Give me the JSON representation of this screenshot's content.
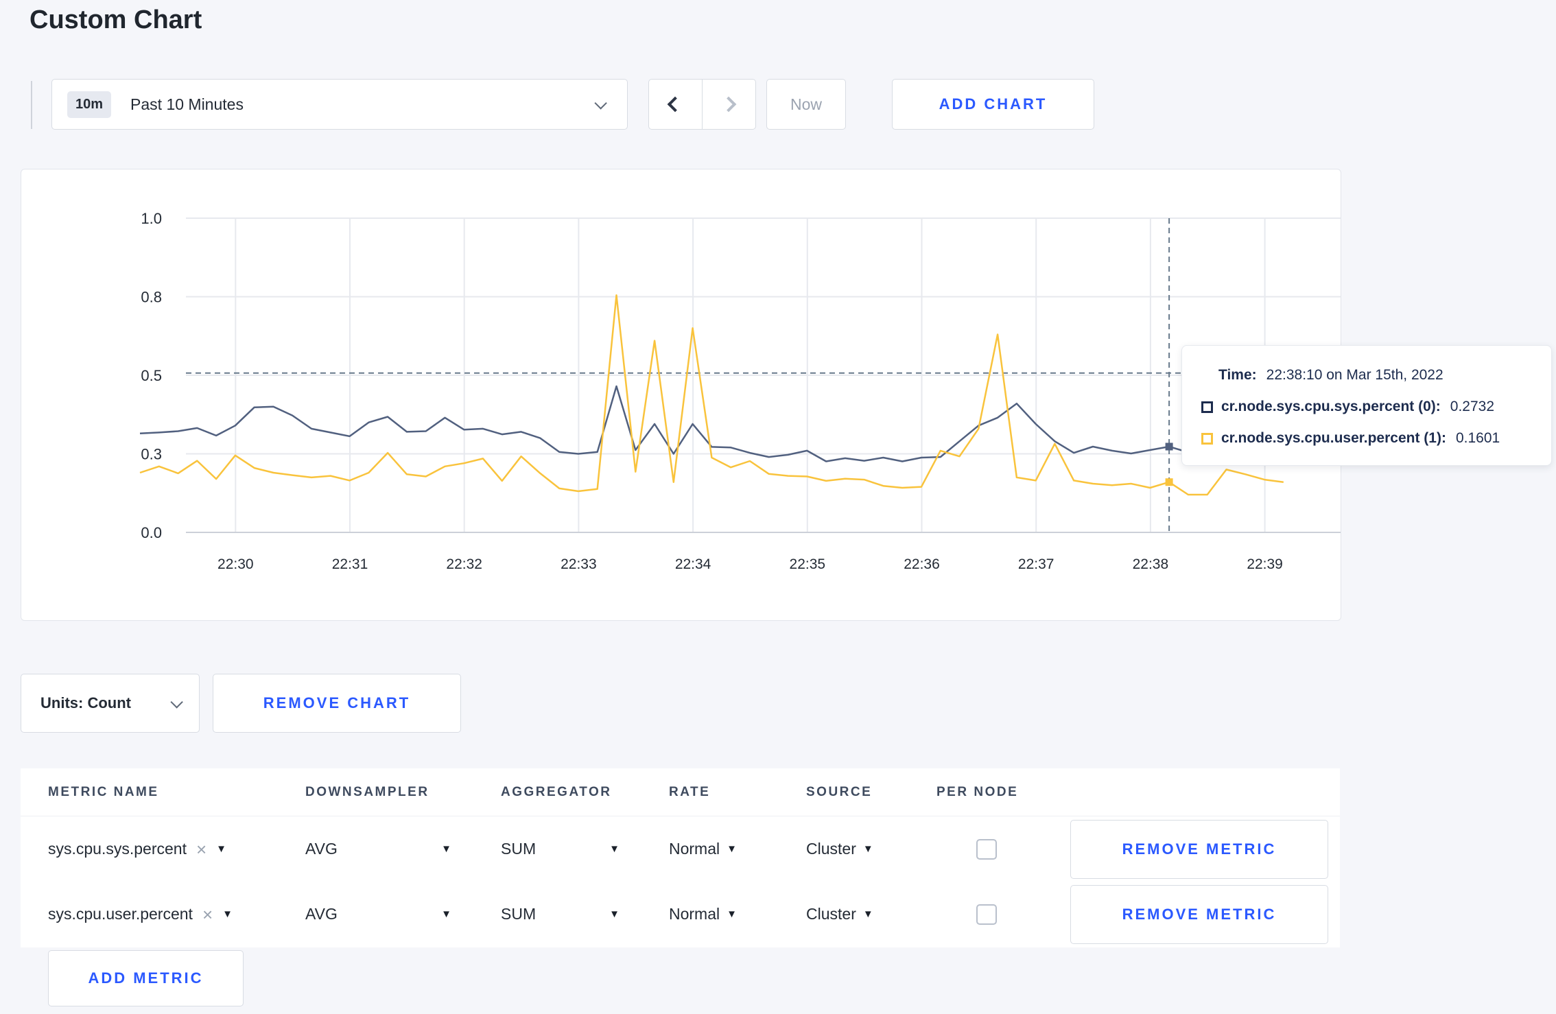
{
  "page": {
    "title": "Custom Chart"
  },
  "toolbar": {
    "range_badge": "10m",
    "range_label": "Past 10 Minutes",
    "prev_label": "previous time window",
    "next_label": "next time window",
    "now_label": "Now",
    "add_chart_label": "ADD CHART"
  },
  "chart_data": {
    "type": "line",
    "title": "",
    "xlabel": "",
    "ylabel": "",
    "ylim": [
      0,
      1
    ],
    "grid": true,
    "legend_position": "tooltip-only",
    "y_ticks": [
      "0.0",
      "0.3",
      "0.5",
      "0.8",
      "1.0"
    ],
    "y_tick_values": [
      0,
      0.25,
      0.5,
      0.75,
      1.0
    ],
    "x_ticks": [
      "22:30",
      "22:31",
      "22:32",
      "22:33",
      "22:34",
      "22:35",
      "22:36",
      "22:37",
      "22:38",
      "22:39"
    ],
    "x_start": "22:29:10",
    "x_step_seconds": 10,
    "hover_index": 54,
    "hover_time": "22:38:10",
    "hover_line_value": 0.507,
    "series": [
      {
        "name": "cr.node.sys.cpu.sys.percent",
        "color": "#51607f",
        "values": [
          0.315,
          0.318,
          0.322,
          0.332,
          0.308,
          0.34,
          0.398,
          0.4,
          0.372,
          0.33,
          0.318,
          0.306,
          0.35,
          0.368,
          0.32,
          0.322,
          0.365,
          0.327,
          0.33,
          0.312,
          0.32,
          0.3,
          0.256,
          0.25,
          0.256,
          0.465,
          0.262,
          0.345,
          0.25,
          0.345,
          0.272,
          0.27,
          0.253,
          0.24,
          0.247,
          0.26,
          0.226,
          0.236,
          0.228,
          0.238,
          0.226,
          0.238,
          0.24,
          0.29,
          0.34,
          0.365,
          0.41,
          0.345,
          0.29,
          0.253,
          0.273,
          0.26,
          0.251,
          0.262,
          0.273,
          0.255,
          0.27,
          0.295,
          0.3,
          0.295,
          0.305
        ]
      },
      {
        "name": "cr.node.sys.cpu.user.percent",
        "color": "#f9c33c",
        "values": [
          0.19,
          0.21,
          0.188,
          0.228,
          0.17,
          0.245,
          0.205,
          0.19,
          0.182,
          0.175,
          0.18,
          0.165,
          0.19,
          0.253,
          0.185,
          0.178,
          0.21,
          0.22,
          0.235,
          0.164,
          0.242,
          0.188,
          0.14,
          0.131,
          0.138,
          0.755,
          0.193,
          0.61,
          0.16,
          0.65,
          0.238,
          0.207,
          0.227,
          0.186,
          0.18,
          0.178,
          0.164,
          0.171,
          0.168,
          0.148,
          0.142,
          0.145,
          0.26,
          0.242,
          0.33,
          0.63,
          0.175,
          0.165,
          0.282,
          0.165,
          0.155,
          0.15,
          0.155,
          0.142,
          0.16,
          0.12,
          0.12,
          0.2,
          0.185,
          0.168,
          0.16
        ]
      }
    ]
  },
  "tooltip": {
    "time_label": "Time:",
    "time_value": "22:38:10 on Mar 15th, 2022",
    "rows": [
      {
        "label": "cr.node.sys.cpu.sys.percent (0):",
        "value": "0.2732",
        "color": "#1d2c4e"
      },
      {
        "label": "cr.node.sys.cpu.user.percent (1):",
        "value": "0.1601",
        "color": "#f9c33c"
      }
    ]
  },
  "chart_actions": {
    "units_label": "Units: Count",
    "remove_chart_label": "REMOVE CHART"
  },
  "metrics_table": {
    "headers": [
      "METRIC NAME",
      "DOWNSAMPLER",
      "AGGREGATOR",
      "RATE",
      "SOURCE",
      "PER NODE"
    ],
    "rows": [
      {
        "metric": "sys.cpu.sys.percent",
        "downsampler": "AVG",
        "aggregator": "SUM",
        "rate": "Normal",
        "source": "Cluster",
        "per_node_checked": false,
        "remove_label": "REMOVE METRIC"
      },
      {
        "metric": "sys.cpu.user.percent",
        "downsampler": "AVG",
        "aggregator": "SUM",
        "rate": "Normal",
        "source": "Cluster",
        "per_node_checked": false,
        "remove_label": "REMOVE METRIC"
      }
    ],
    "add_metric_label": "ADD METRIC"
  },
  "colors": {
    "accent_blue": "#2b59ff",
    "navy_text": "#1d2c4e",
    "series_sys": "#51607f",
    "series_user": "#f9c33c",
    "gridline": "#e7e9ee",
    "axis_line": "#ccd0d8",
    "crosshair": "#66788a",
    "page_bg": "#f5f6fa"
  }
}
